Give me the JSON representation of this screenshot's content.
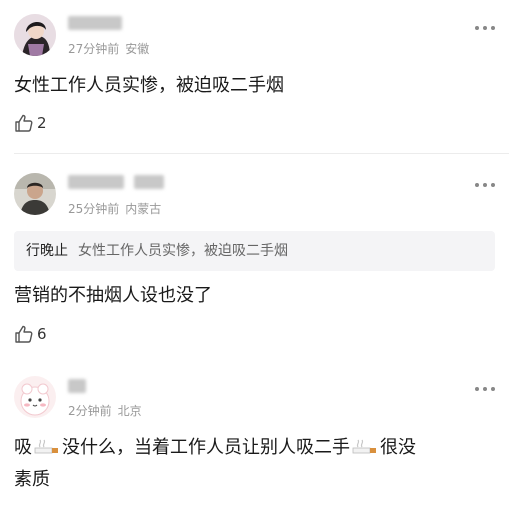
{
  "comments": [
    {
      "time": "27分钟前",
      "location": "安徽",
      "text": "女性工作人员实惨，被迫吸二手烟",
      "likes": "2"
    },
    {
      "time": "25分钟前",
      "location": "内蒙古",
      "quote_name": "行晚止",
      "quote_text": "女性工作人员实惨，被迫吸二手烟",
      "text": "营销的不抽烟人设也没了",
      "likes": "6"
    },
    {
      "time": "2分钟前",
      "location": "北京",
      "text_1": "吸",
      "text_2": "没什么，当着工作人员让别人吸二手",
      "text_3": "很没",
      "text_4": "素质"
    }
  ],
  "icons": {
    "more": "more-dots-icon",
    "like": "thumbs-up-icon",
    "smoking": "cigarette-icon"
  }
}
